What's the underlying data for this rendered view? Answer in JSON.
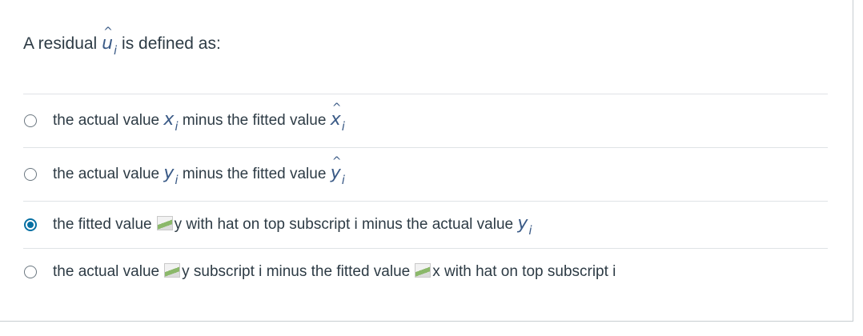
{
  "question": {
    "prefix": "A residual",
    "var": "u",
    "sub": "i",
    "suffix": "is defined as:"
  },
  "answers": [
    {
      "selected": false,
      "prefix": "the actual value",
      "var1": "x",
      "sub1": "i",
      "middle": "minus the fitted value",
      "var2": "x",
      "sub2": "i"
    },
    {
      "selected": false,
      "prefix": "the actual value",
      "var1": "y",
      "sub1": "i",
      "middle": "minus the fitted value",
      "var2": "y",
      "sub2": "i"
    },
    {
      "selected": true,
      "prefix": "the fitted value",
      "alt1": "y with hat on top subscript i",
      "middle": "minus the actual value",
      "var2": "y",
      "sub2": "i"
    },
    {
      "selected": false,
      "prefix": "the actual value",
      "alt1": "y subscript i",
      "middle": "minus the fitted value",
      "alt2": "x with hat on top subscript i"
    }
  ],
  "hat_glyph": "^"
}
